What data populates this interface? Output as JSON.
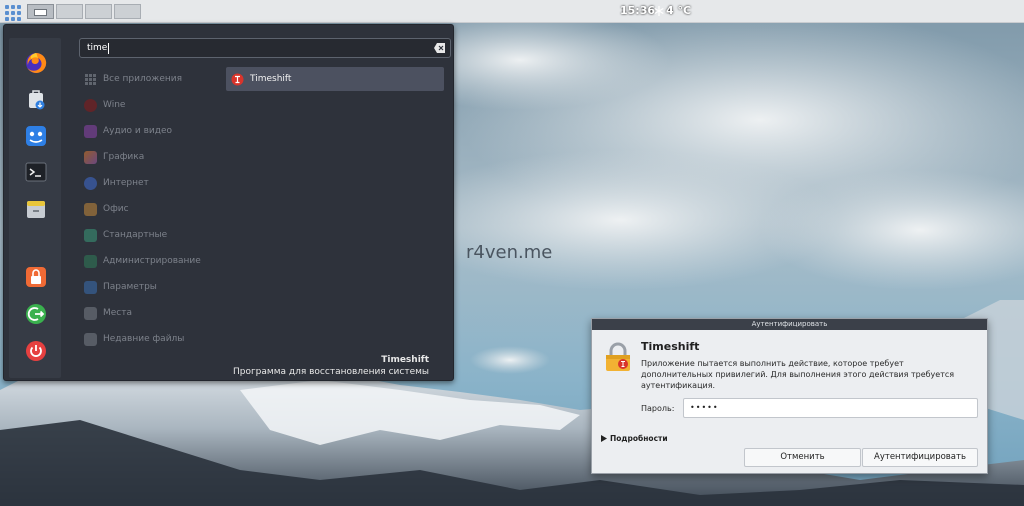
{
  "panel": {
    "clock": "15:36",
    "weather": "4 °C"
  },
  "watermark": "r4ven.me",
  "menu": {
    "search": {
      "value": "time"
    },
    "categories": [
      {
        "label": "Все приложения",
        "icon": "grid-icon",
        "color": "#6e737c"
      },
      {
        "label": "Wine",
        "icon": "wine-icon",
        "color": "#8b1a1a"
      },
      {
        "label": "Аудио и видео",
        "icon": "multimedia-icon",
        "color": "#8e44ad"
      },
      {
        "label": "Графика",
        "icon": "graphics-icon",
        "color": "#e67e22"
      },
      {
        "label": "Интернет",
        "icon": "internet-icon",
        "color": "#3f6ed6"
      },
      {
        "label": "Офис",
        "icon": "office-icon",
        "color": "#c78a3a"
      },
      {
        "label": "Стандартные",
        "icon": "accessories-icon",
        "color": "#3a9a7a"
      },
      {
        "label": "Администрирование",
        "icon": "administration-icon",
        "color": "#2f7d5a"
      },
      {
        "label": "Параметры",
        "icon": "preferences-icon",
        "color": "#3b6fb3"
      },
      {
        "label": "Места",
        "icon": "places-icon",
        "color": "#7a7f88"
      },
      {
        "label": "Недавние файлы",
        "icon": "recent-files-icon",
        "color": "#7a7f88"
      }
    ],
    "result": {
      "label": "Timeshift",
      "icon": "timeshift-icon"
    },
    "footer": {
      "name": "Timeshift",
      "description": "Программа для восстановления системы"
    }
  },
  "auth_dialog": {
    "window_title": "Аутентифицировать",
    "heading": "Timeshift",
    "message": "Приложение пытается выполнить действие, которое требует дополнительных привилегий. Для выполнения этого действия требуется аутентификация.",
    "password_label": "Пароль:",
    "password_value": "•••••",
    "details_label": "Подробности",
    "cancel_label": "Отменить",
    "ok_label": "Аутентифицировать"
  }
}
